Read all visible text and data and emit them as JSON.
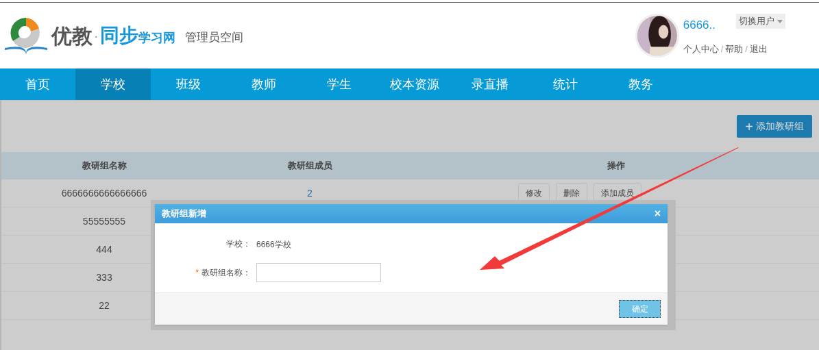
{
  "header": {
    "logo_text_1": "优教",
    "logo_dot": "·",
    "logo_text_2": "同步",
    "logo_text_3": "学习网",
    "subtitle": "管理员空间",
    "user": {
      "name": "6666..",
      "switch_label": "切换用户",
      "links": [
        "个人中心",
        "帮助",
        "退出"
      ],
      "separator": "/"
    }
  },
  "nav": [
    {
      "label": "首页",
      "selected": false
    },
    {
      "label": "学校",
      "selected": true
    },
    {
      "label": "班级",
      "selected": false
    },
    {
      "label": "教师",
      "selected": false
    },
    {
      "label": "学生",
      "selected": false
    },
    {
      "label": "校本资源",
      "selected": false
    },
    {
      "label": "录直播",
      "selected": false
    },
    {
      "label": "统计",
      "selected": false
    },
    {
      "label": "教务",
      "selected": false
    }
  ],
  "add_button": {
    "icon": "+",
    "label": "添加教研组"
  },
  "table": {
    "columns": [
      "教研组名称",
      "教研组成员",
      "操作"
    ],
    "rows": [
      {
        "name": "6666666666666666",
        "members": "2",
        "actions": [
          "修改",
          "删除",
          "添加成员"
        ]
      },
      {
        "name": "55555555"
      },
      {
        "name": "444"
      },
      {
        "name": "333"
      },
      {
        "name": "22"
      }
    ]
  },
  "dialog": {
    "title": "教研组新增",
    "close": "×",
    "fields": [
      {
        "kind": "text",
        "label": "学校：",
        "value": "6666学校"
      },
      {
        "kind": "input",
        "label": "教研组名称：",
        "required_mark": "*"
      }
    ],
    "confirm": "确定"
  }
}
